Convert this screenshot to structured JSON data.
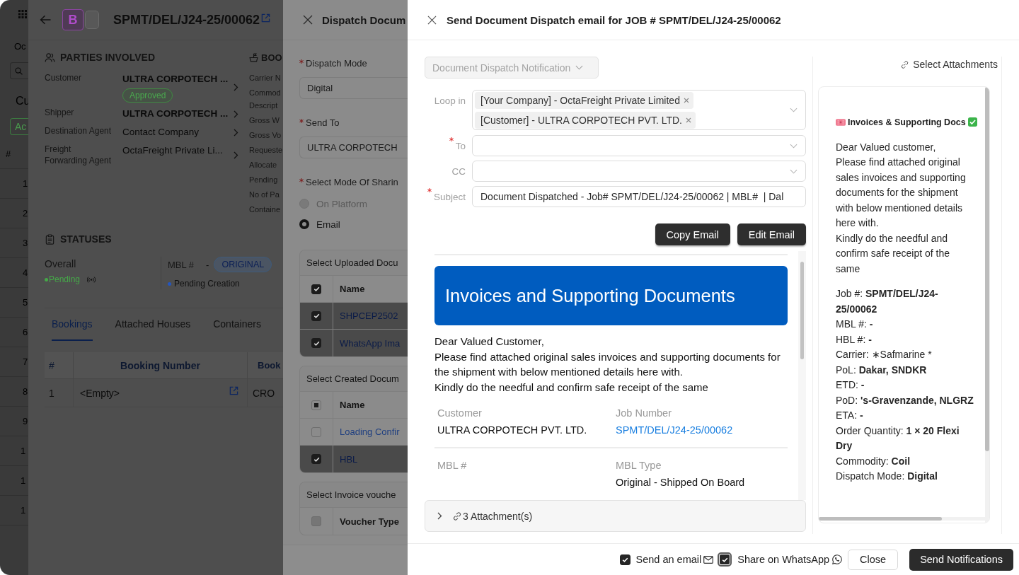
{
  "app_sidebar": {
    "label": "Oc",
    "heading": "Cu",
    "filter_tag": "Ac",
    "column_header": "#",
    "row_numbers": [
      "1",
      "2",
      "3",
      "4",
      "5",
      "6",
      "7",
      "8",
      "9",
      "1",
      "1",
      "1"
    ]
  },
  "job_panel": {
    "badge": "B",
    "title": "SPMT/DEL/J24-25/00062",
    "parties": {
      "heading": "PARTIES INVOLVED",
      "rows": [
        {
          "label": "Customer",
          "value": "ULTRA CORPOTECH ...",
          "bold": true,
          "badge": "Approved"
        },
        {
          "label": "Shipper",
          "value": "ULTRA CORPOTECH ...",
          "bold": true
        },
        {
          "label": "Destination Agent",
          "value": "Contact Company",
          "bold": false
        },
        {
          "label": "Freight Forwarding Agent",
          "value": "OctaFreight Private Li...",
          "bold": false
        }
      ]
    },
    "booking": {
      "heading": "BOO",
      "labels": [
        "Carrier N",
        "Commod Descript",
        "Gross W",
        "Gross Vo",
        "Requeste",
        "Allocate",
        "Pending",
        "No of Pa",
        "Containe"
      ]
    },
    "statuses": {
      "heading": "STATUSES",
      "overall": {
        "label": "Overall",
        "value": "Pending"
      },
      "mbl": {
        "label": "MBL #",
        "number": "-",
        "badge": "ORIGINAL",
        "value": "Pending Creation"
      }
    },
    "tabs": [
      {
        "label": "Bookings",
        "selected": true
      },
      {
        "label": "Attached Houses",
        "selected": false
      },
      {
        "label": "Containers",
        "selected": false
      }
    ],
    "table": {
      "columns": [
        "#",
        "Booking Number",
        "Book"
      ],
      "rows": [
        [
          "1",
          "<Empty>",
          "CRO"
        ]
      ]
    }
  },
  "dispatch_panel": {
    "title": "Dispatch Docum",
    "fields": [
      {
        "label": "Dispatch Mode",
        "required": true,
        "value": "Digital"
      },
      {
        "label": "Send To",
        "required": true,
        "value": "ULTRA CORPOTECH"
      }
    ],
    "sharing": {
      "label": "Select Mode Of Sharin",
      "required": true,
      "options": [
        {
          "label": "On Platform",
          "selected": false,
          "disabled": true
        },
        {
          "label": "Email",
          "selected": true,
          "disabled": false
        }
      ]
    },
    "sections": [
      {
        "title": "Select Uploaded Docu",
        "header": {
          "label": "Name",
          "checked": true,
          "indeterminate": false,
          "disabled": false
        },
        "rows": [
          {
            "name": "SHPCEP2502",
            "checked": true
          },
          {
            "name": "WhatsApp Ima",
            "checked": true
          }
        ]
      },
      {
        "title": "Select Created Docum",
        "header": {
          "label": "Name",
          "checked": false,
          "indeterminate": true,
          "disabled": false
        },
        "rows": [
          {
            "name": "Loading Confir",
            "checked": false
          },
          {
            "name": "HBL",
            "checked": true
          }
        ]
      },
      {
        "title": "Select Invoice vouche",
        "header": {
          "label": "Voucher Type",
          "checked": false,
          "indeterminate": false,
          "disabled": true
        }
      }
    ]
  },
  "email_panel": {
    "title": "Send Document Dispatch email for JOB # SPMT/DEL/J24-25/00062",
    "template": {
      "value": "Document Dispatch Notification",
      "disabled": true
    },
    "select_attachments": "Select Attachments",
    "loop_in": {
      "label": "Loop in",
      "required": false,
      "tags": [
        "[Your Company] - OctaFreight Private Limited",
        "[Customer] - ULTRA CORPOTECH PVT. LTD."
      ]
    },
    "to": {
      "label": "To",
      "required": true
    },
    "cc": {
      "label": "CC",
      "required": false
    },
    "subject": {
      "label": "Subject",
      "required": true,
      "value": "Document Dispatched - Job# SPMT/DEL/J24-25/00062 | MBL#  | Dal"
    },
    "actions": [
      "Copy Email",
      "Edit Email"
    ],
    "preview": {
      "banner": "Invoices and Supporting Documents",
      "message": "Dear Valued Customer,\nPlease find attached original sales invoices and supporting documents for the shipment with below mentioned details here with.\nKindly do the needful and confirm safe receipt of the same",
      "detail_rows": [
        [
          {
            "label": "Customer",
            "value": "ULTRA CORPOTECH PVT. LTD.",
            "link": false
          },
          {
            "label": "Job Number",
            "value": "SPMT/DEL/J24-25/00062",
            "link": true
          }
        ],
        [
          {
            "label": "MBL #"
          },
          {
            "label": "MBL Type",
            "value": "Original - Shipped On Board",
            "link": false
          }
        ]
      ]
    },
    "attachments": {
      "label": "3 Attachment(s)",
      "expanded": false
    },
    "whatsapp_preview": {
      "title": "Invoices & Supporting Docs",
      "message": "Dear Valued customer,\nPlease find attached original sales invoices and supporting documents for the shipment with below mentioned details here with.\nKindly do the needful and confirm safe receipt of the same",
      "details": [
        "Job #: **SPMT/DEL/J24-25/00062**",
        "MBL #: **-**",
        "HBL #: **-**",
        "Carrier: ∗Safmarine *",
        "PoL: **Dakar, SNDKR**",
        "ETD: **-**",
        "PoD: **'s-Gravenzande, NLGRZ**",
        "ETA: **-**",
        "Order Quantity: **1 × 20 Flexi Dry**",
        "Commodity: **Coil**",
        "Dispatch Mode: **Digital**"
      ]
    },
    "footer": {
      "options": [
        {
          "label": "Send an email",
          "kind": "email",
          "checked": true,
          "focused": false
        },
        {
          "label": "Share on WhatsApp",
          "kind": "whatsapp",
          "checked": true,
          "focused": true
        }
      ],
      "buttons": [
        {
          "label": "Close",
          "kind": "secondary"
        },
        {
          "label": "Send Notifications",
          "kind": "primary"
        }
      ]
    }
  }
}
